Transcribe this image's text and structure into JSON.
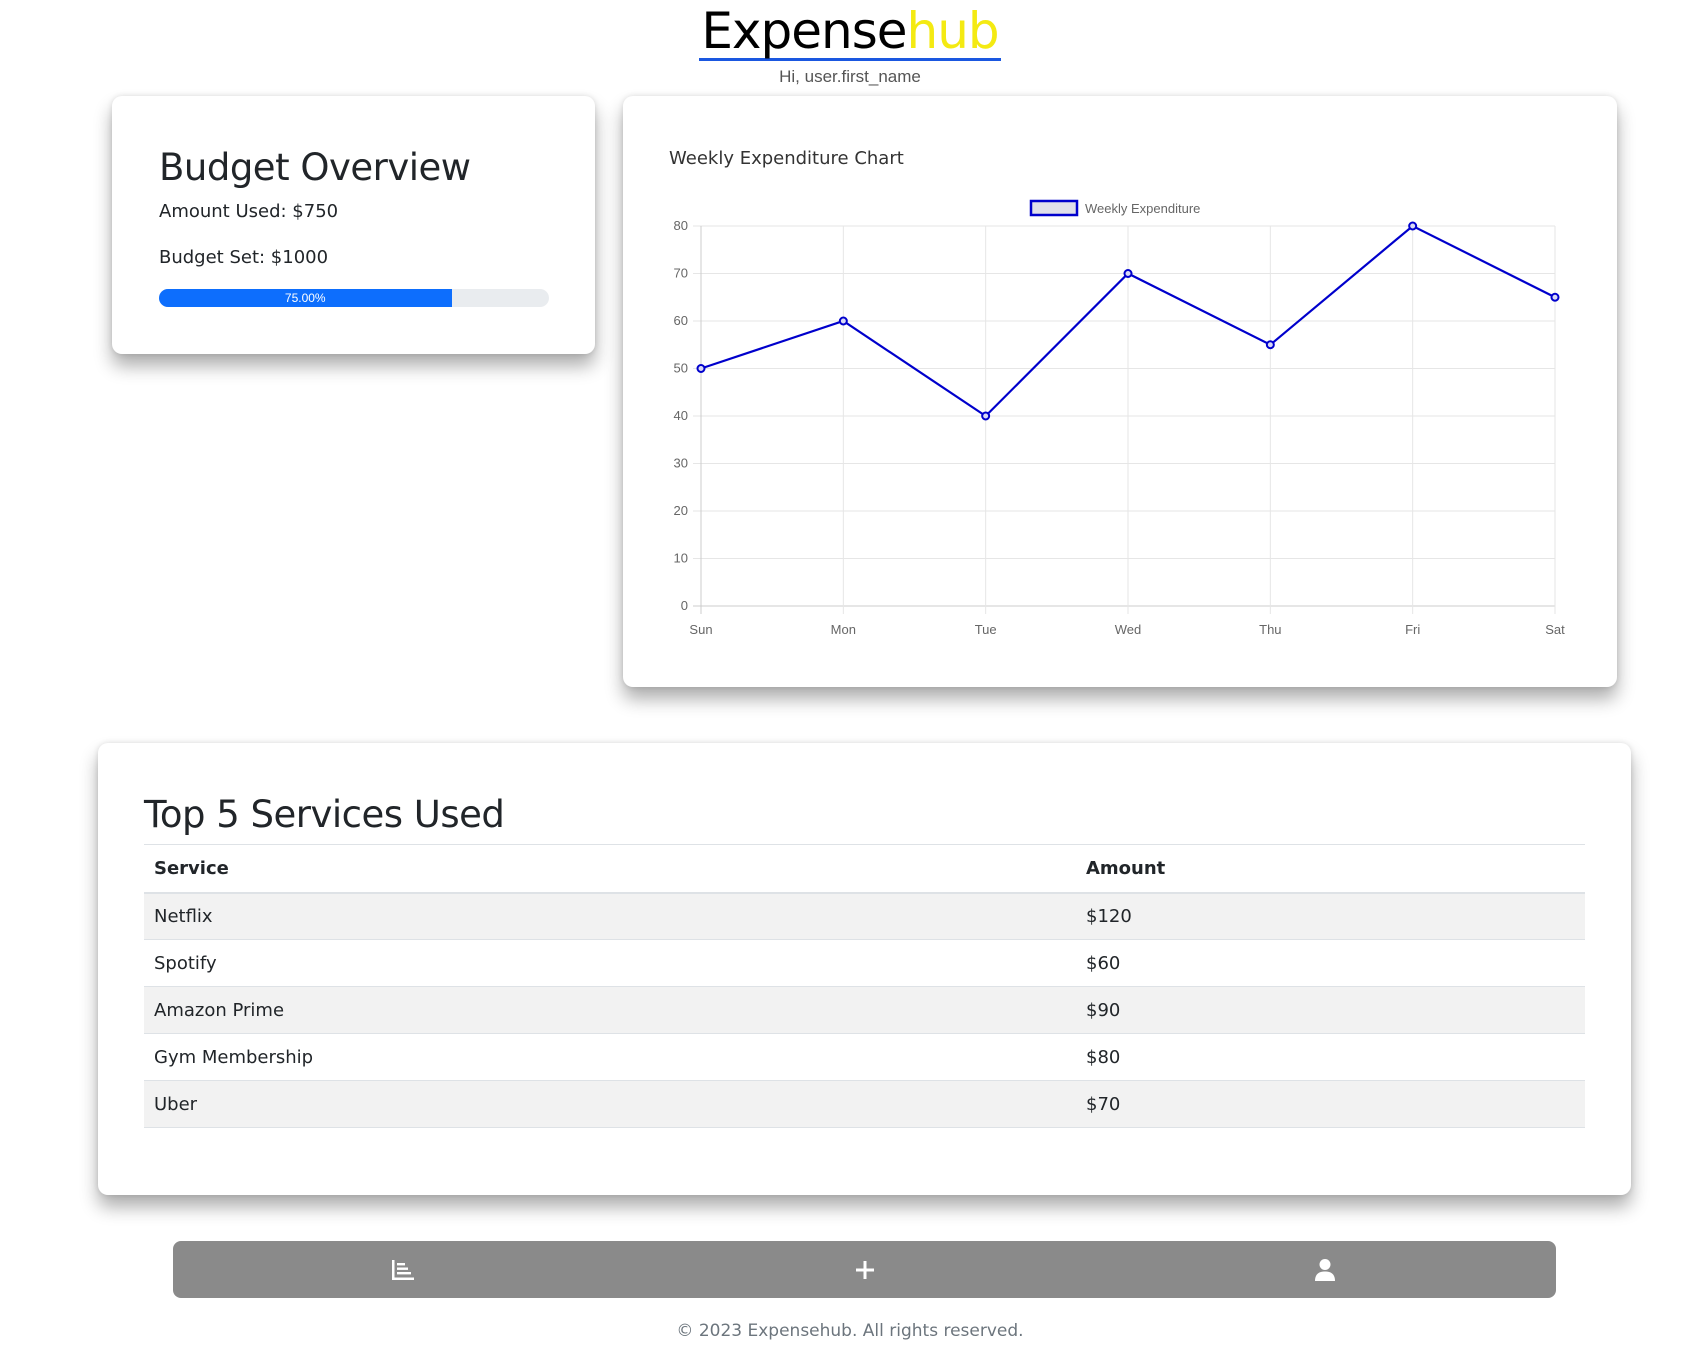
{
  "header": {
    "logo_part1": "Expense",
    "logo_part2": "hub",
    "greeting": "Hi, user.first_name"
  },
  "budget": {
    "title": "Budget Overview",
    "amount_used": "Amount Used: $750",
    "budget_set": "Budget Set: $1000",
    "progress_label": "75.00%",
    "progress_fraction": 0.75
  },
  "chart_data": {
    "type": "line",
    "title": "Weekly Expenditure Chart",
    "categories": [
      "Sun",
      "Mon",
      "Tue",
      "Wed",
      "Thu",
      "Fri",
      "Sat"
    ],
    "series": [
      {
        "name": "Weekly Expenditure",
        "values": [
          50,
          60,
          40,
          70,
          55,
          80,
          65
        ],
        "color": "#0000cc"
      }
    ],
    "ylim": [
      0,
      80
    ],
    "yticks": [
      0,
      10,
      20,
      30,
      40,
      50,
      60,
      70,
      80
    ],
    "grid": true,
    "legend": "top-center"
  },
  "services": {
    "title": "Top 5 Services Used",
    "headers": [
      "Service",
      "Amount"
    ],
    "rows": [
      [
        "Netflix",
        "$120"
      ],
      [
        "Spotify",
        "$60"
      ],
      [
        "Amazon Prime",
        "$90"
      ],
      [
        "Gym Membership",
        "$80"
      ],
      [
        "Uber",
        "$70"
      ]
    ]
  },
  "nav": {
    "items": [
      {
        "icon": "bar-chart-icon"
      },
      {
        "icon": "plus-icon"
      },
      {
        "icon": "user-icon"
      }
    ]
  },
  "footer": {
    "text": "© 2023 Expensehub. All rights reserved."
  },
  "colors": {
    "progress": "#0d6efd",
    "nav_bg": "#8a8a8a",
    "logo_accent": "#f4ea12",
    "logo_underline": "#1a57e0"
  }
}
